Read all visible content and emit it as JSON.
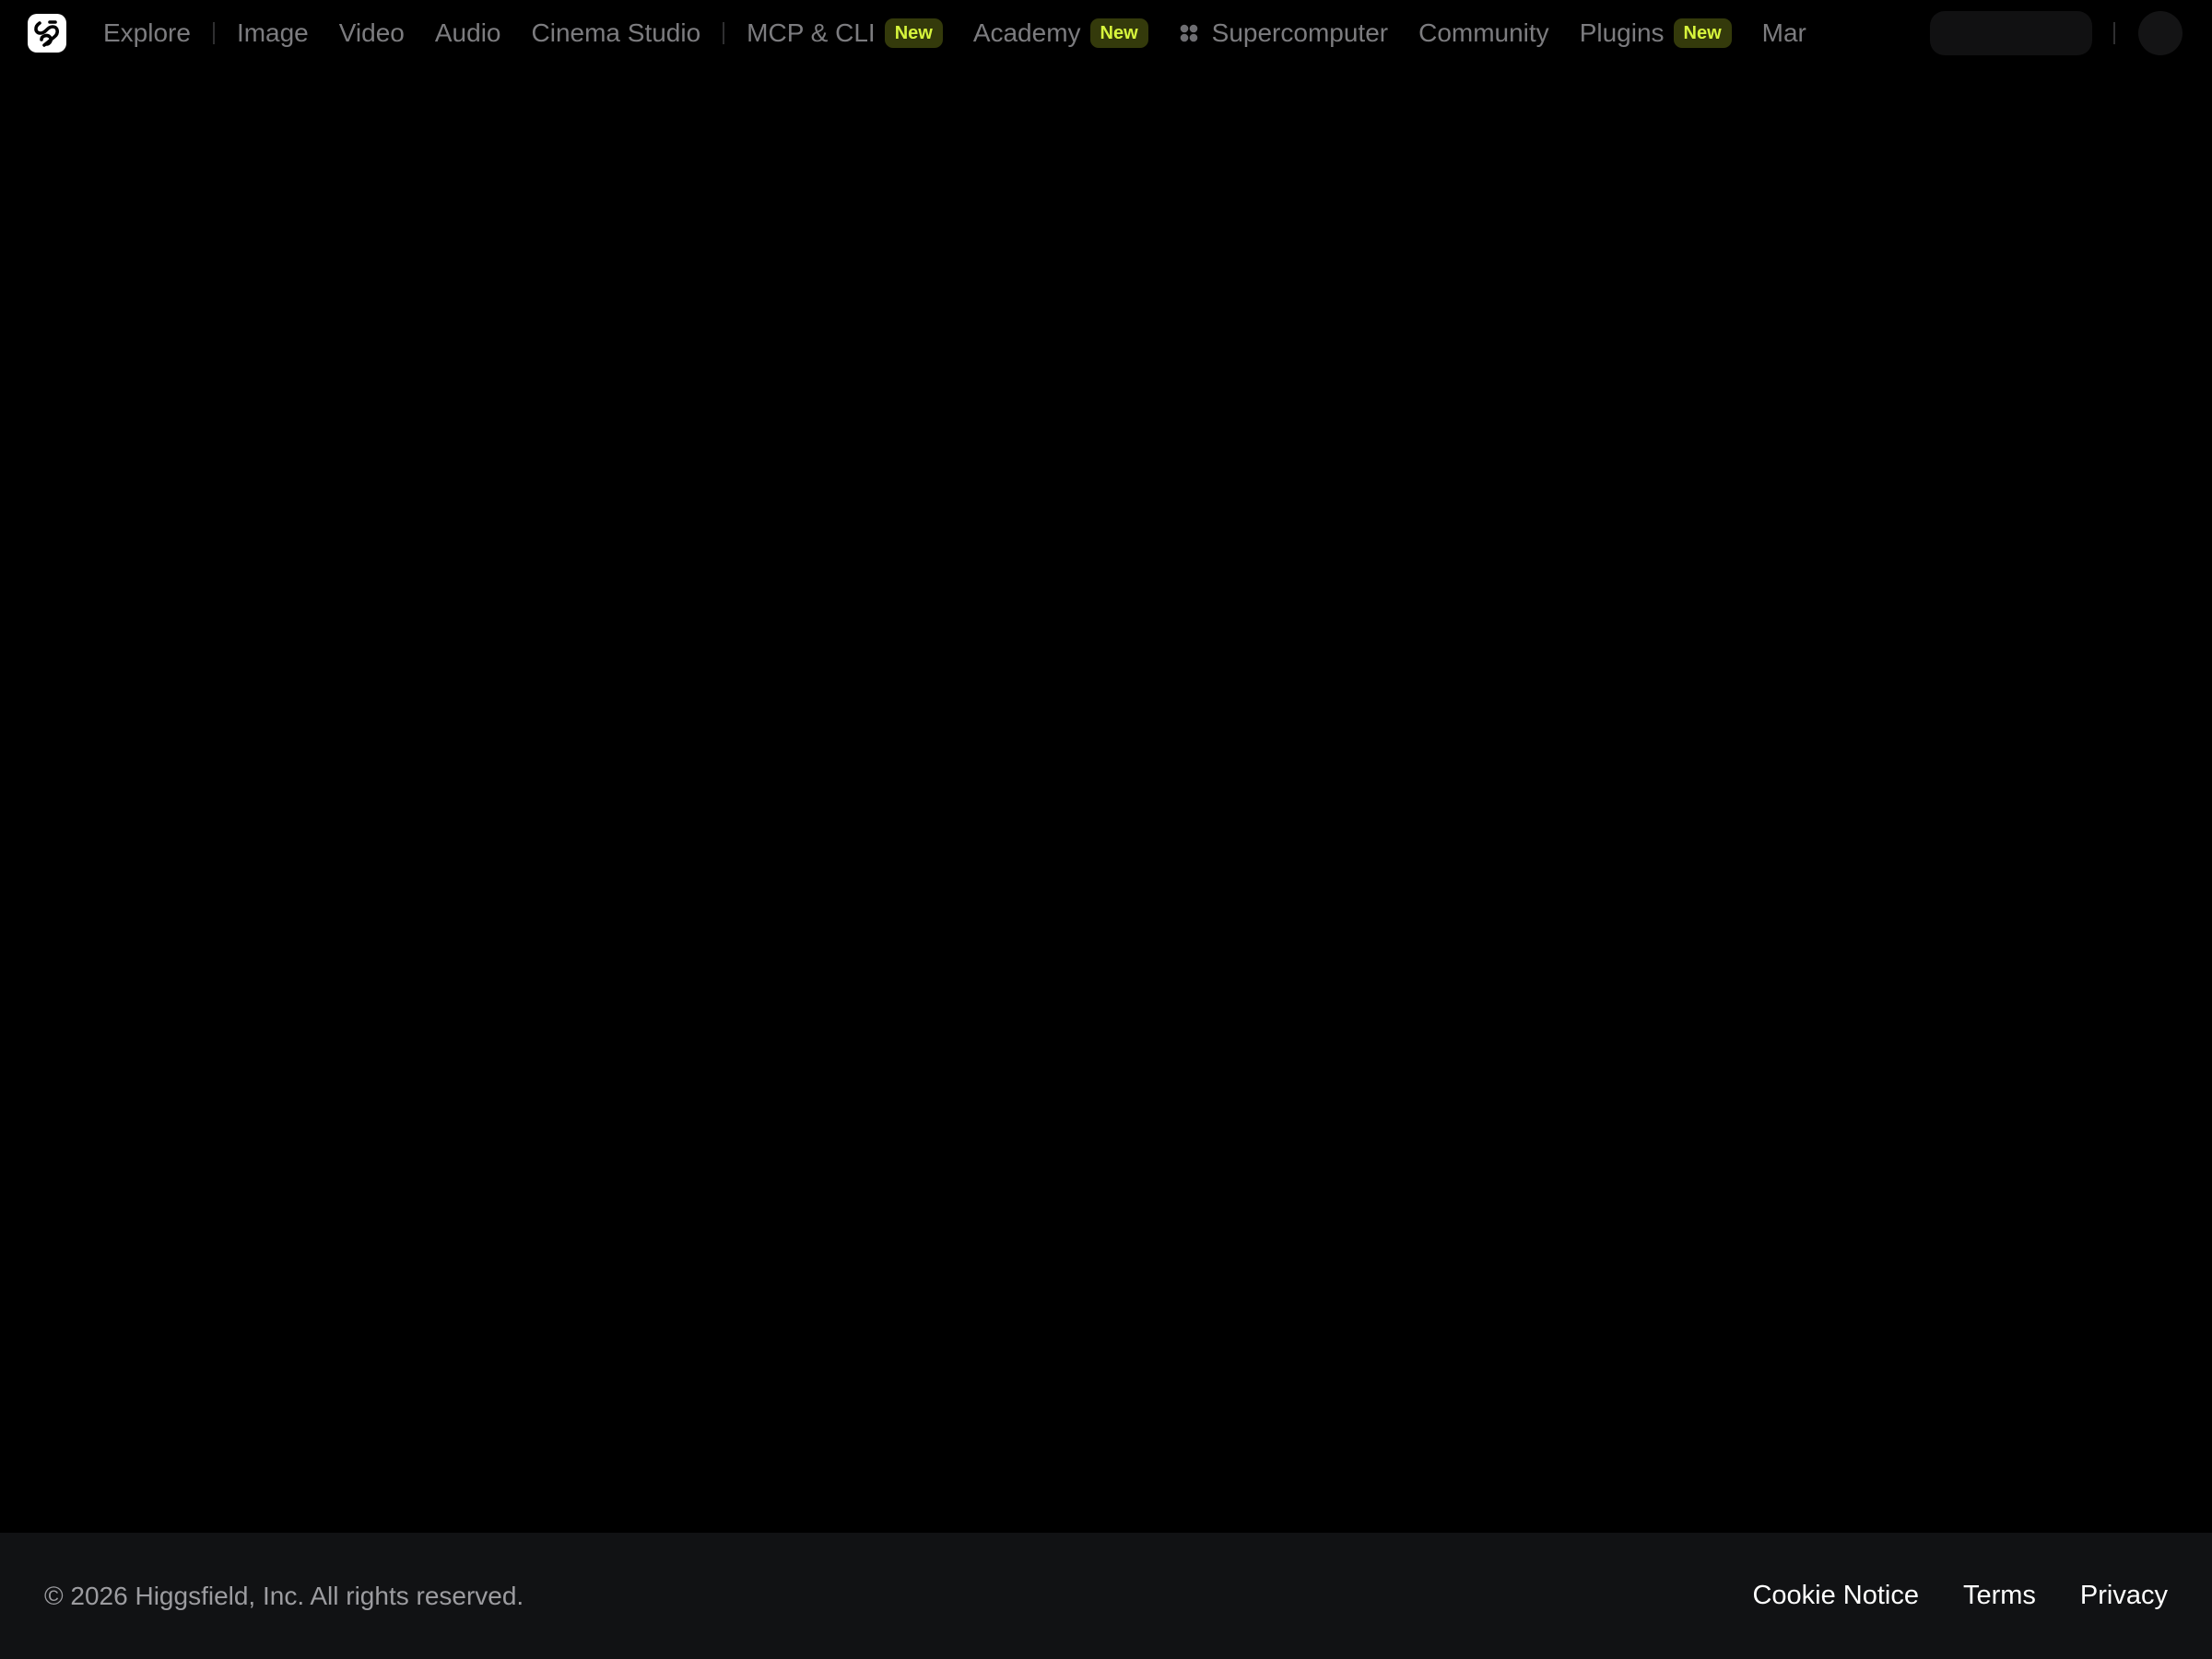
{
  "nav": {
    "explore": "Explore",
    "image": "Image",
    "video": "Video",
    "audio": "Audio",
    "cinema_studio": "Cinema Studio",
    "mcp_cli": "MCP & CLI",
    "mcp_cli_badge": "New",
    "academy": "Academy",
    "academy_badge": "New",
    "supercomputer": "Supercomputer",
    "community": "Community",
    "plugins": "Plugins",
    "plugins_badge": "New",
    "marketplace_truncated": "Mar"
  },
  "icons": {
    "logo": "higgsfield-logo-icon",
    "supercomputer": "four-dots-icon"
  },
  "colors": {
    "background": "#000000",
    "nav_text": "#7c7c7f",
    "badge_bg": "#343a0b",
    "badge_text": "#d7f53c",
    "footer_bg": "#111214"
  },
  "footer": {
    "copyright": "© 2026 Higgsfield, Inc. All rights reserved.",
    "links": [
      "Cookie Notice",
      "Terms",
      "Privacy"
    ]
  }
}
